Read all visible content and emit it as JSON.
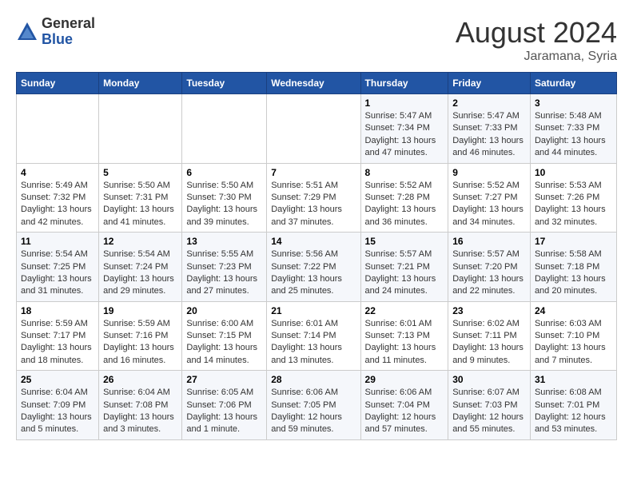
{
  "logo": {
    "general": "General",
    "blue": "Blue"
  },
  "title": {
    "month": "August 2024",
    "location": "Jaramana, Syria"
  },
  "headers": [
    "Sunday",
    "Monday",
    "Tuesday",
    "Wednesday",
    "Thursday",
    "Friday",
    "Saturday"
  ],
  "weeks": [
    [
      {
        "day": "",
        "sunrise": "",
        "sunset": "",
        "daylight": ""
      },
      {
        "day": "",
        "sunrise": "",
        "sunset": "",
        "daylight": ""
      },
      {
        "day": "",
        "sunrise": "",
        "sunset": "",
        "daylight": ""
      },
      {
        "day": "",
        "sunrise": "",
        "sunset": "",
        "daylight": ""
      },
      {
        "day": "1",
        "sunrise": "Sunrise: 5:47 AM",
        "sunset": "Sunset: 7:34 PM",
        "daylight": "Daylight: 13 hours and 47 minutes."
      },
      {
        "day": "2",
        "sunrise": "Sunrise: 5:47 AM",
        "sunset": "Sunset: 7:33 PM",
        "daylight": "Daylight: 13 hours and 46 minutes."
      },
      {
        "day": "3",
        "sunrise": "Sunrise: 5:48 AM",
        "sunset": "Sunset: 7:33 PM",
        "daylight": "Daylight: 13 hours and 44 minutes."
      }
    ],
    [
      {
        "day": "4",
        "sunrise": "Sunrise: 5:49 AM",
        "sunset": "Sunset: 7:32 PM",
        "daylight": "Daylight: 13 hours and 42 minutes."
      },
      {
        "day": "5",
        "sunrise": "Sunrise: 5:50 AM",
        "sunset": "Sunset: 7:31 PM",
        "daylight": "Daylight: 13 hours and 41 minutes."
      },
      {
        "day": "6",
        "sunrise": "Sunrise: 5:50 AM",
        "sunset": "Sunset: 7:30 PM",
        "daylight": "Daylight: 13 hours and 39 minutes."
      },
      {
        "day": "7",
        "sunrise": "Sunrise: 5:51 AM",
        "sunset": "Sunset: 7:29 PM",
        "daylight": "Daylight: 13 hours and 37 minutes."
      },
      {
        "day": "8",
        "sunrise": "Sunrise: 5:52 AM",
        "sunset": "Sunset: 7:28 PM",
        "daylight": "Daylight: 13 hours and 36 minutes."
      },
      {
        "day": "9",
        "sunrise": "Sunrise: 5:52 AM",
        "sunset": "Sunset: 7:27 PM",
        "daylight": "Daylight: 13 hours and 34 minutes."
      },
      {
        "day": "10",
        "sunrise": "Sunrise: 5:53 AM",
        "sunset": "Sunset: 7:26 PM",
        "daylight": "Daylight: 13 hours and 32 minutes."
      }
    ],
    [
      {
        "day": "11",
        "sunrise": "Sunrise: 5:54 AM",
        "sunset": "Sunset: 7:25 PM",
        "daylight": "Daylight: 13 hours and 31 minutes."
      },
      {
        "day": "12",
        "sunrise": "Sunrise: 5:54 AM",
        "sunset": "Sunset: 7:24 PM",
        "daylight": "Daylight: 13 hours and 29 minutes."
      },
      {
        "day": "13",
        "sunrise": "Sunrise: 5:55 AM",
        "sunset": "Sunset: 7:23 PM",
        "daylight": "Daylight: 13 hours and 27 minutes."
      },
      {
        "day": "14",
        "sunrise": "Sunrise: 5:56 AM",
        "sunset": "Sunset: 7:22 PM",
        "daylight": "Daylight: 13 hours and 25 minutes."
      },
      {
        "day": "15",
        "sunrise": "Sunrise: 5:57 AM",
        "sunset": "Sunset: 7:21 PM",
        "daylight": "Daylight: 13 hours and 24 minutes."
      },
      {
        "day": "16",
        "sunrise": "Sunrise: 5:57 AM",
        "sunset": "Sunset: 7:20 PM",
        "daylight": "Daylight: 13 hours and 22 minutes."
      },
      {
        "day": "17",
        "sunrise": "Sunrise: 5:58 AM",
        "sunset": "Sunset: 7:18 PM",
        "daylight": "Daylight: 13 hours and 20 minutes."
      }
    ],
    [
      {
        "day": "18",
        "sunrise": "Sunrise: 5:59 AM",
        "sunset": "Sunset: 7:17 PM",
        "daylight": "Daylight: 13 hours and 18 minutes."
      },
      {
        "day": "19",
        "sunrise": "Sunrise: 5:59 AM",
        "sunset": "Sunset: 7:16 PM",
        "daylight": "Daylight: 13 hours and 16 minutes."
      },
      {
        "day": "20",
        "sunrise": "Sunrise: 6:00 AM",
        "sunset": "Sunset: 7:15 PM",
        "daylight": "Daylight: 13 hours and 14 minutes."
      },
      {
        "day": "21",
        "sunrise": "Sunrise: 6:01 AM",
        "sunset": "Sunset: 7:14 PM",
        "daylight": "Daylight: 13 hours and 13 minutes."
      },
      {
        "day": "22",
        "sunrise": "Sunrise: 6:01 AM",
        "sunset": "Sunset: 7:13 PM",
        "daylight": "Daylight: 13 hours and 11 minutes."
      },
      {
        "day": "23",
        "sunrise": "Sunrise: 6:02 AM",
        "sunset": "Sunset: 7:11 PM",
        "daylight": "Daylight: 13 hours and 9 minutes."
      },
      {
        "day": "24",
        "sunrise": "Sunrise: 6:03 AM",
        "sunset": "Sunset: 7:10 PM",
        "daylight": "Daylight: 13 hours and 7 minutes."
      }
    ],
    [
      {
        "day": "25",
        "sunrise": "Sunrise: 6:04 AM",
        "sunset": "Sunset: 7:09 PM",
        "daylight": "Daylight: 13 hours and 5 minutes."
      },
      {
        "day": "26",
        "sunrise": "Sunrise: 6:04 AM",
        "sunset": "Sunset: 7:08 PM",
        "daylight": "Daylight: 13 hours and 3 minutes."
      },
      {
        "day": "27",
        "sunrise": "Sunrise: 6:05 AM",
        "sunset": "Sunset: 7:06 PM",
        "daylight": "Daylight: 13 hours and 1 minute."
      },
      {
        "day": "28",
        "sunrise": "Sunrise: 6:06 AM",
        "sunset": "Sunset: 7:05 PM",
        "daylight": "Daylight: 12 hours and 59 minutes."
      },
      {
        "day": "29",
        "sunrise": "Sunrise: 6:06 AM",
        "sunset": "Sunset: 7:04 PM",
        "daylight": "Daylight: 12 hours and 57 minutes."
      },
      {
        "day": "30",
        "sunrise": "Sunrise: 6:07 AM",
        "sunset": "Sunset: 7:03 PM",
        "daylight": "Daylight: 12 hours and 55 minutes."
      },
      {
        "day": "31",
        "sunrise": "Sunrise: 6:08 AM",
        "sunset": "Sunset: 7:01 PM",
        "daylight": "Daylight: 12 hours and 53 minutes."
      }
    ]
  ]
}
